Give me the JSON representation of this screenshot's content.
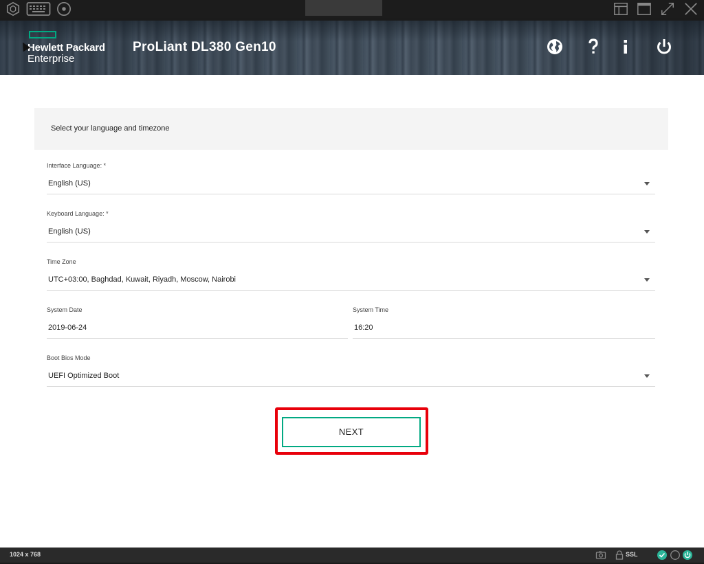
{
  "toolbar": {
    "left_icons": [
      "hub-icon",
      "keyboard-icon",
      "disc-icon"
    ],
    "right_icons": [
      "layout-icon",
      "window-icon",
      "fullscreen-icon",
      "close-icon"
    ]
  },
  "header": {
    "brand_line1": "Hewlett Packard",
    "brand_line2": "Enterprise",
    "product": "ProLiant DL380 Gen10",
    "brand_color": "#01a982",
    "actions": [
      "language-globe-icon",
      "help-icon",
      "info-icon",
      "power-icon"
    ]
  },
  "form": {
    "section_title": "Select your language and timezone",
    "interface_language": {
      "label": "Interface Language: *",
      "value": "English (US)"
    },
    "keyboard_language": {
      "label": "Keyboard Language: *",
      "value": "English (US)"
    },
    "time_zone": {
      "label": "Time Zone",
      "value": "UTC+03:00, Baghdad, Kuwait, Riyadh, Moscow, Nairobi"
    },
    "system_date": {
      "label": "System Date",
      "value": "2019-06-24"
    },
    "system_time": {
      "label": "System Time",
      "value": "16:20"
    },
    "boot_mode": {
      "label": "Boot Bios Mode",
      "value": "UEFI Optimized Boot"
    },
    "next_label": "NEXT",
    "highlight_color": "#e8000b"
  },
  "statusbar": {
    "resolution": "1024 x 768",
    "ssl": "SSL",
    "icons": [
      "camera-icon",
      "lock-icon",
      "check-status-icon",
      "empty-status-icon",
      "power-status-icon"
    ]
  }
}
